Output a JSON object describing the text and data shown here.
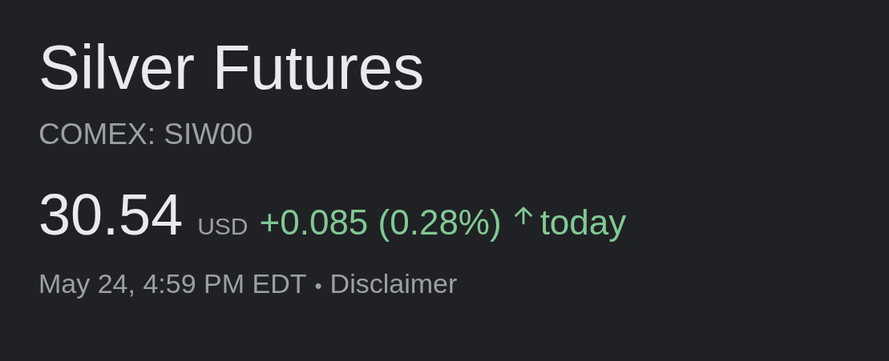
{
  "title": "Silver Futures",
  "symbol": "COMEX: SIW00",
  "quote": {
    "price": "30.54",
    "currency": "USD",
    "change": "+0.085 (0.28%)",
    "rising": true,
    "period": "today"
  },
  "footer": {
    "timestamp": "May 24, 4:59 PM EDT",
    "separator": "•",
    "disclaimer": "Disclaimer"
  }
}
